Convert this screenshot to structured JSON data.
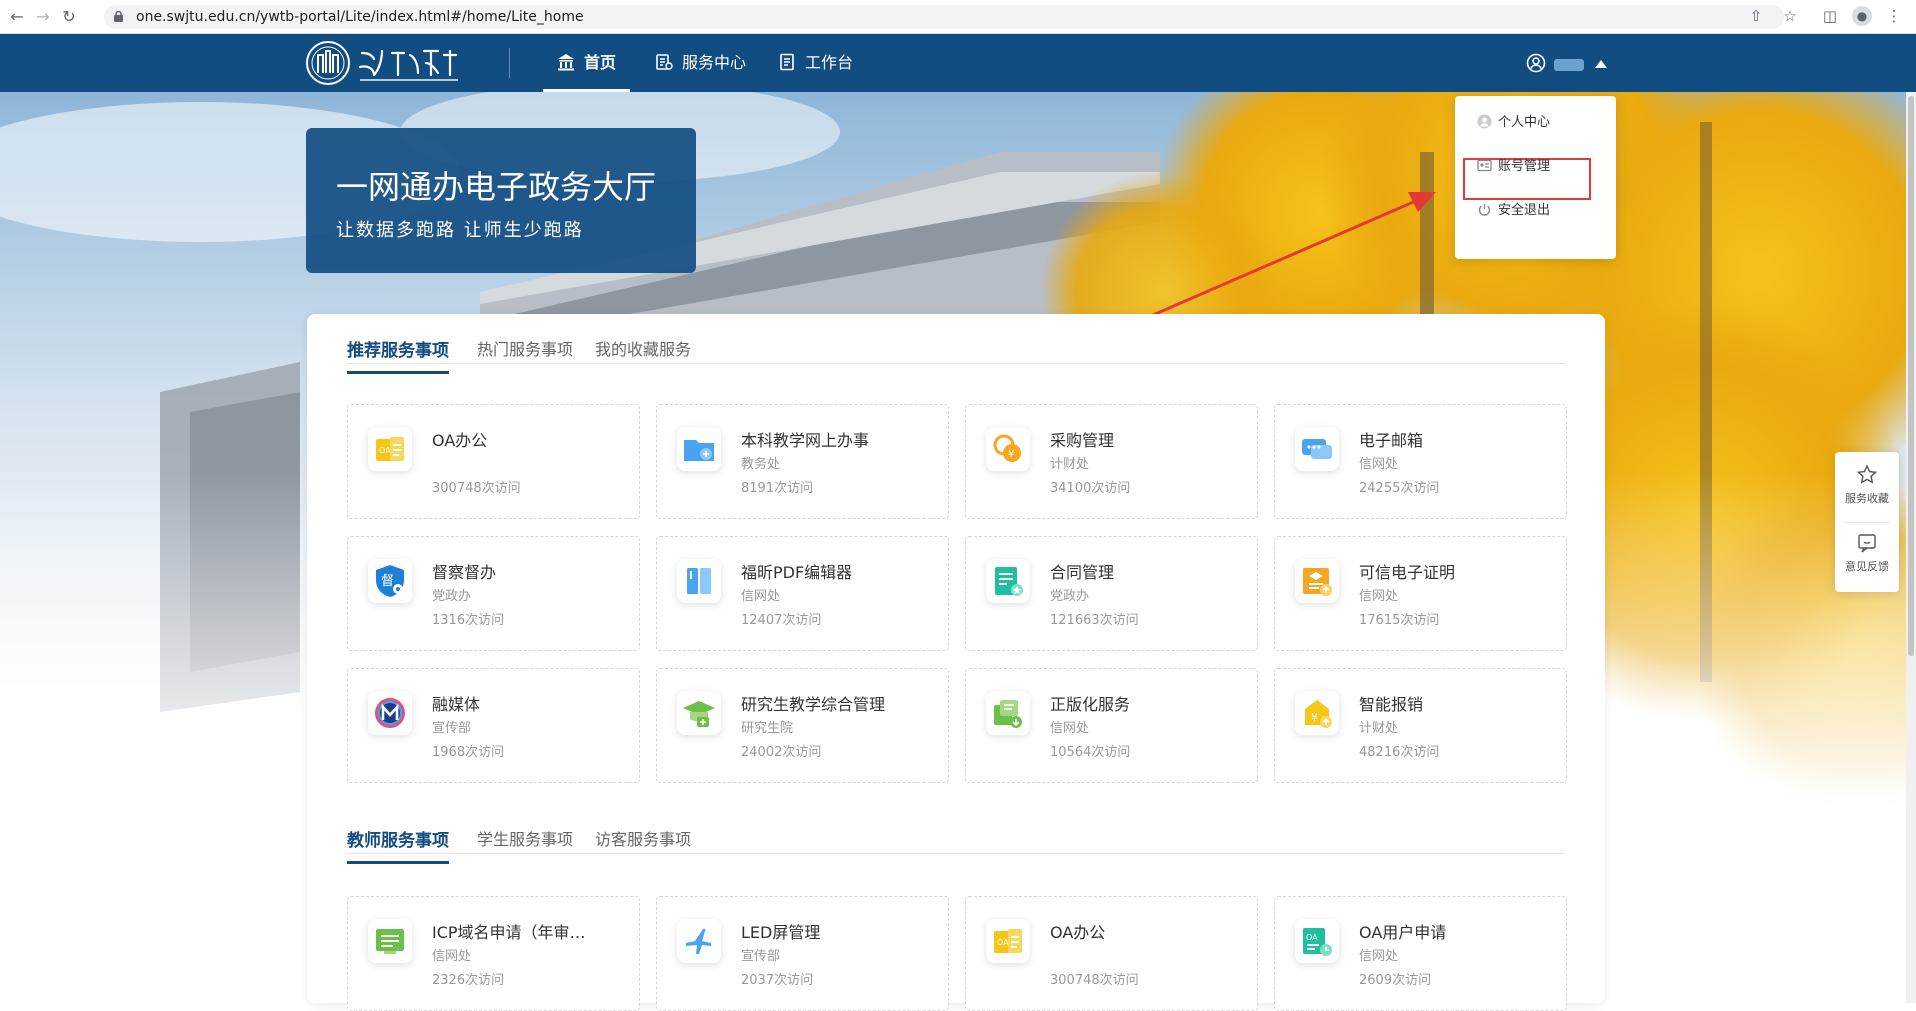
{
  "browser": {
    "url": "one.swjtu.edu.cn/ywtb-portal/Lite/index.html#/home/Lite_home"
  },
  "header": {
    "nav": [
      {
        "label": "首页",
        "icon": "bank-icon",
        "active": true
      },
      {
        "label": "服务中心",
        "icon": "service-icon",
        "active": false
      },
      {
        "label": "工作台",
        "icon": "desk-icon",
        "active": false
      }
    ]
  },
  "user_menu": {
    "items": [
      {
        "label": "个人中心",
        "icon": "person-icon"
      },
      {
        "label": "账号管理",
        "icon": "id-card-icon",
        "highlighted": true
      },
      {
        "label": "安全退出",
        "icon": "power-icon"
      }
    ]
  },
  "banner": {
    "title": "一网通办电子政务大厅",
    "subtitle": "让数据多跑路 让师生少跑路"
  },
  "section1": {
    "tabs": [
      {
        "label": "推荐服务事项",
        "active": true
      },
      {
        "label": "热门服务事项",
        "active": false
      },
      {
        "label": "我的收藏服务",
        "active": false
      }
    ],
    "services": [
      {
        "name": "OA办公",
        "dept": "",
        "visits": "300748次访问",
        "icon": "oa-icon",
        "color": "#f5c518"
      },
      {
        "name": "本科教学网上办事",
        "dept": "教务处",
        "visits": "8191次访问",
        "icon": "folder-icon",
        "color": "#4aa3f0"
      },
      {
        "name": "采购管理",
        "dept": "计财处",
        "visits": "34100次访问",
        "icon": "purchase-icon",
        "color": "#f5a623"
      },
      {
        "name": "电子邮箱",
        "dept": "信网处",
        "visits": "24255次访问",
        "icon": "chat-icon",
        "color": "#4aa3f0"
      },
      {
        "name": "督察督办",
        "dept": "党政办",
        "visits": "1316次访问",
        "icon": "shield-eye-icon",
        "color": "#1e7fd6"
      },
      {
        "name": "福昕PDF编辑器",
        "dept": "信网处",
        "visits": "12407次访问",
        "icon": "book-icon",
        "color": "#4aa3f0"
      },
      {
        "name": "合同管理",
        "dept": "党政办",
        "visits": "121663次访问",
        "icon": "contract-icon",
        "color": "#1fbfa0"
      },
      {
        "name": "可信电子证明",
        "dept": "信网处",
        "visits": "17615次访问",
        "icon": "certificate-icon",
        "color": "#f5a623"
      },
      {
        "name": "融媒体",
        "dept": "宣传部",
        "visits": "1968次访问",
        "icon": "media-icon",
        "color": "#1e3a8a"
      },
      {
        "name": "研究生教学综合管理",
        "dept": "研究生院",
        "visits": "24002次访问",
        "icon": "graduate-icon",
        "color": "#6cc04a"
      },
      {
        "name": "正版化服务",
        "dept": "信网处",
        "visits": "10564次访问",
        "icon": "software-icon",
        "color": "#6cc04a"
      },
      {
        "name": "智能报销",
        "dept": "计财处",
        "visits": "48216次访问",
        "icon": "reimburse-icon",
        "color": "#f5c518"
      }
    ]
  },
  "section2": {
    "tabs": [
      {
        "label": "教师服务事项",
        "active": true
      },
      {
        "label": "学生服务事项",
        "active": false
      },
      {
        "label": "访客服务事项",
        "active": false
      }
    ],
    "services": [
      {
        "name": "ICP域名申请（年审…",
        "dept": "信网处",
        "visits": "2326次访问",
        "icon": "icp-icon",
        "color": "#6cc04a"
      },
      {
        "name": "LED屏管理",
        "dept": "宣传部",
        "visits": "2037次访问",
        "icon": "plane-icon",
        "color": "#4aa3f0"
      },
      {
        "name": "OA办公",
        "dept": "",
        "visits": "300748次访问",
        "icon": "oa-icon",
        "color": "#f5c518"
      },
      {
        "name": "OA用户申请",
        "dept": "信网处",
        "visits": "2609次访问",
        "icon": "oa-user-icon",
        "color": "#1fbfa0"
      }
    ]
  },
  "side_tools": [
    {
      "label": "服务收藏",
      "icon": "star-icon"
    },
    {
      "label": "意见反馈",
      "icon": "feedback-icon"
    }
  ],
  "colors": {
    "brand": "#124d82",
    "highlight": "#e03c3c"
  }
}
